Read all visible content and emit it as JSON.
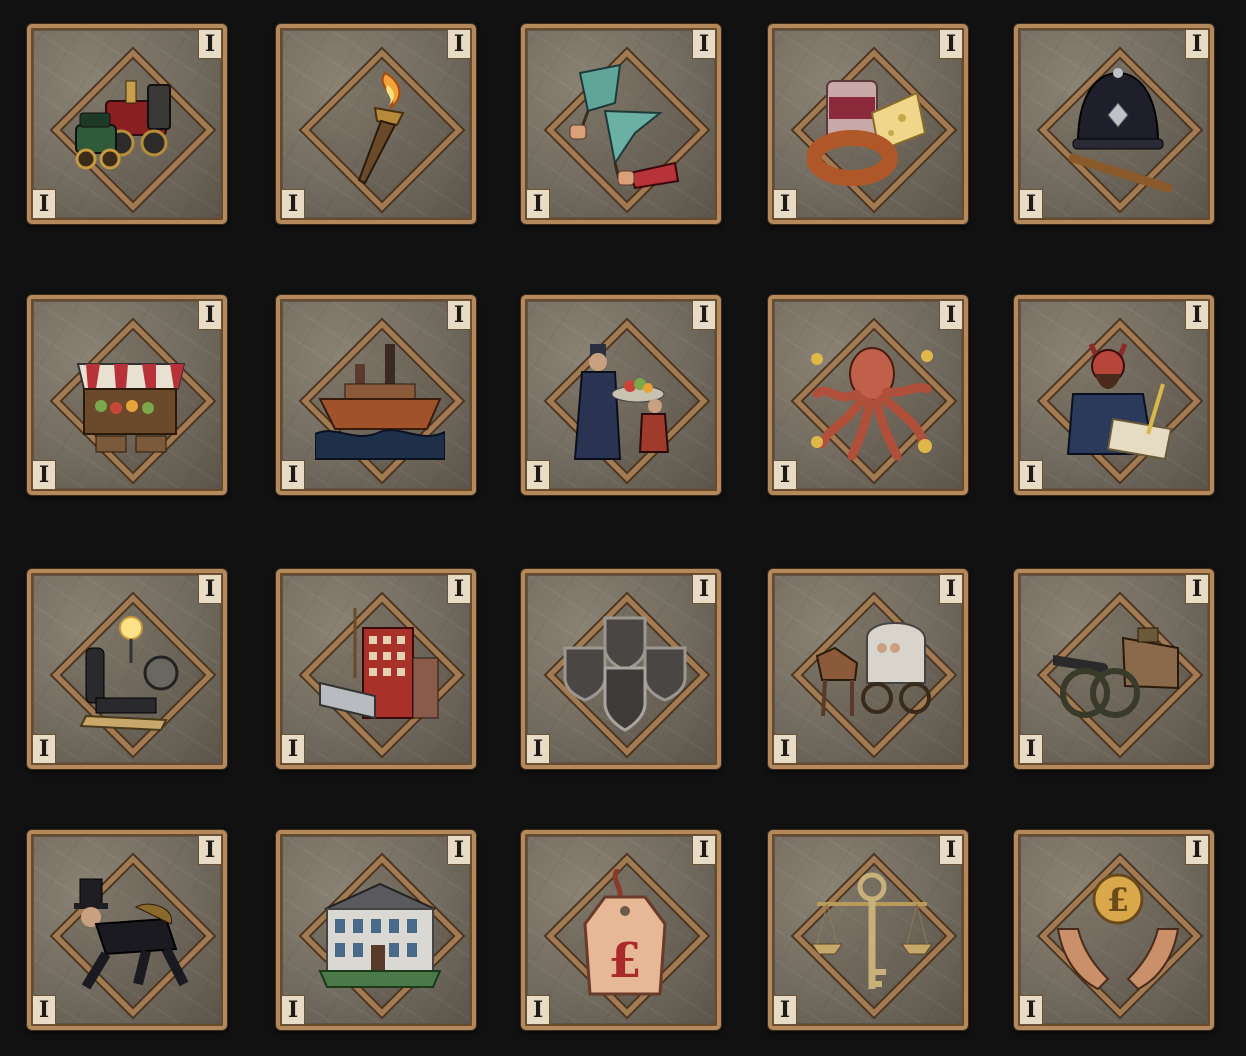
{
  "tier_label": "I",
  "cards": [
    {
      "icon": "locomotive-car-icon"
    },
    {
      "icon": "torch-icon"
    },
    {
      "icon": "signal-flags-icon"
    },
    {
      "icon": "sardine-can-cheese-sausage-icon"
    },
    {
      "icon": "police-helmet-baton-icon"
    },
    {
      "icon": "market-stall-icon"
    },
    {
      "icon": "steamship-icon"
    },
    {
      "icon": "kneeling-offering-icon"
    },
    {
      "icon": "octopus-icon"
    },
    {
      "icon": "devil-signing-contract-icon"
    },
    {
      "icon": "electric-generator-bulb-icon"
    },
    {
      "icon": "steel-girder-building-icon"
    },
    {
      "icon": "four-shields-icon"
    },
    {
      "icon": "horse-carriage-icon"
    },
    {
      "icon": "cannon-tank-icon"
    },
    {
      "icon": "crawling-gentleman-icon"
    },
    {
      "icon": "mansion-icon"
    },
    {
      "icon": "pound-price-tag-icon"
    },
    {
      "icon": "scales-key-icon"
    },
    {
      "icon": "hands-pound-coin-icon"
    }
  ]
}
